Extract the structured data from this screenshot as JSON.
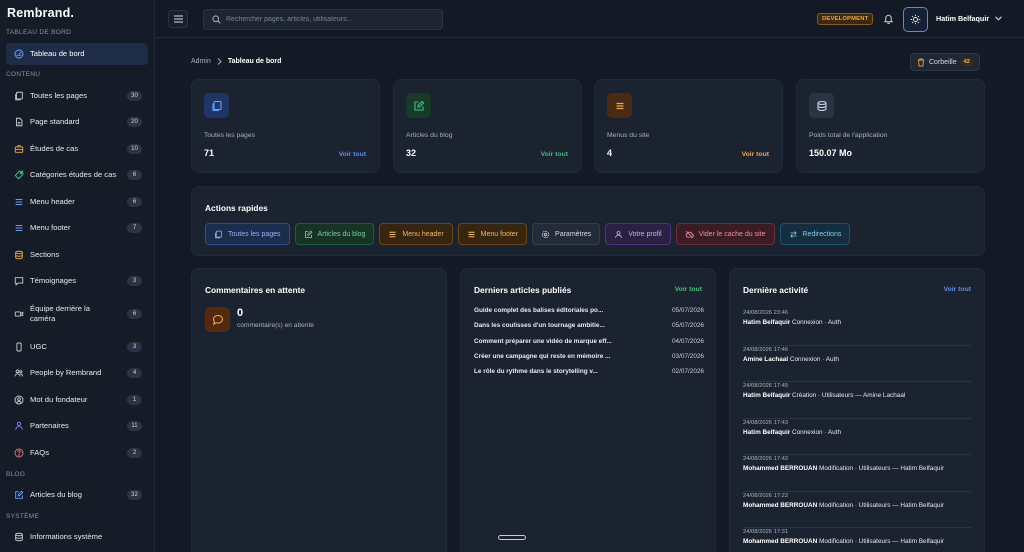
{
  "brand": "Rembrand.",
  "sidebar": {
    "sections": {
      "dashboard": "TABLEAU DE BORD",
      "content": "CONTENU",
      "blog": "BLOG",
      "system": "SYSTÈME"
    },
    "items": [
      {
        "label": "Tableau de bord",
        "icon": "dashboard-icon",
        "count": ""
      },
      {
        "label": "Toutes les pages",
        "icon": "pages-icon",
        "count": "30"
      },
      {
        "label": "Page standard",
        "icon": "document-icon",
        "count": "20"
      },
      {
        "label": "Études de cas",
        "icon": "briefcase-icon",
        "count": "10"
      },
      {
        "label": "Catégories études de cas",
        "icon": "tag-icon",
        "count": "6"
      },
      {
        "label": "Menu header",
        "icon": "menu-icon",
        "count": "6"
      },
      {
        "label": "Menu footer",
        "icon": "menu-icon",
        "count": "7"
      },
      {
        "label": "Sections",
        "icon": "layers-icon",
        "count": ""
      },
      {
        "label": "Témoignages",
        "icon": "comment-icon",
        "count": "3"
      },
      {
        "label": "Équipe derrière la caméra",
        "icon": "camera-icon",
        "count": "6"
      },
      {
        "label": "UGC",
        "icon": "phone-icon",
        "count": "3"
      },
      {
        "label": "People by Rembrand",
        "icon": "people-icon",
        "count": "4"
      },
      {
        "label": "Mot du fondateur",
        "icon": "user-circle-icon",
        "count": "1"
      },
      {
        "label": "Partenaires",
        "icon": "partners-icon",
        "count": "11"
      },
      {
        "label": "FAQs",
        "icon": "help-icon",
        "count": "2"
      },
      {
        "label": "Articles du blog",
        "icon": "edit-icon",
        "count": "32"
      },
      {
        "label": "Informations système",
        "icon": "database-icon",
        "count": ""
      }
    ]
  },
  "topbar": {
    "search_placeholder": "Rechercher pages, articles, utilisateurs...",
    "env": "DEVELOPMENT",
    "user": "Hatim Belfaquir"
  },
  "breadcrumb": {
    "root": "Admin",
    "current": "Tableau de bord"
  },
  "trash": {
    "label": "Corbeille",
    "count": "42"
  },
  "stats": [
    {
      "title": "Toutes les pages",
      "value": "71",
      "link": "Voir tout",
      "icon": "pages-icon",
      "color": "#5b8ef0"
    },
    {
      "title": "Articles du blog",
      "value": "32",
      "link": "Voir tout",
      "icon": "edit-icon",
      "color": "#34c27a"
    },
    {
      "title": "Menus du site",
      "value": "4",
      "link": "Voir tout",
      "icon": "menu-icon",
      "color": "#f0a838"
    },
    {
      "title": "Poids total de l'application",
      "value": "150.07 Mo",
      "link": "",
      "icon": "database-icon",
      "color": "#a9b1bf"
    }
  ],
  "quick_actions": {
    "title": "Actions rapides",
    "buttons": [
      {
        "label": "Toutes les pages",
        "icon": "pages-icon",
        "color": "#6a9cf5"
      },
      {
        "label": "Articles du blog",
        "icon": "edit-icon",
        "color": "#3fc27f"
      },
      {
        "label": "Menu header",
        "icon": "menu-icon",
        "color": "#f0a838"
      },
      {
        "label": "Menu footer",
        "icon": "menu-icon",
        "color": "#f0a838"
      },
      {
        "label": "Paramètres",
        "icon": "gear-icon",
        "color": "#c8ced8"
      },
      {
        "label": "Votre profil",
        "icon": "user-icon",
        "color": "#b48cf5"
      },
      {
        "label": "Vider le cache du site",
        "icon": "cloud-off-icon",
        "color": "#f0707f"
      },
      {
        "label": "Redirections",
        "icon": "redirect-icon",
        "color": "#4fb6e6"
      }
    ]
  },
  "pending": {
    "title": "Commentaires en attente",
    "count": "0",
    "text": "commentaire(s) en attente"
  },
  "articles": {
    "title": "Derniers articles publiés",
    "link": "Voir tout",
    "rows": [
      {
        "title": "Guide complet des balises éditoriales po...",
        "date": "05/07/2026"
      },
      {
        "title": "Dans les coulisses d'un tournage ambitie...",
        "date": "05/07/2026"
      },
      {
        "title": "Comment préparer une vidéo de marque eff...",
        "date": "04/07/2026"
      },
      {
        "title": "Créer une campagne qui reste en mémoire ...",
        "date": "03/07/2026"
      },
      {
        "title": "Le rôle du rythme dans le storytelling v...",
        "date": "02/07/2026"
      }
    ]
  },
  "activity": {
    "title": "Dernière activité",
    "link": "Voir tout",
    "rows": [
      {
        "ts": "24/08/2026 23:46",
        "user": "Hatim Belfaquir",
        "text": "Connexion · Auth"
      },
      {
        "ts": "24/08/2026 17:46",
        "user": "Amine Lachaal",
        "text": "Connexion · Auth"
      },
      {
        "ts": "24/08/2026 17:45",
        "user": "Hatim Belfaquir",
        "text": "Création · Utilisateurs — Amine Lachaal"
      },
      {
        "ts": "24/08/2026 17:43",
        "user": "Hatim Belfaquir",
        "text": "Connexion · Auth"
      },
      {
        "ts": "24/08/2026 17:42",
        "user": "Mohammed BERROUAN",
        "text": "Modification · Utilisateurs — Hatim Belfaquir"
      },
      {
        "ts": "24/08/2026 17:22",
        "user": "Mohammed BERROUAN",
        "text": "Modification · Utilisateurs — Hatim Belfaquir"
      },
      {
        "ts": "24/08/2026 17:31",
        "user": "Mohammed BERROUAN",
        "text": "Modification · Utilisateurs — Hatim Belfaquir"
      }
    ]
  }
}
